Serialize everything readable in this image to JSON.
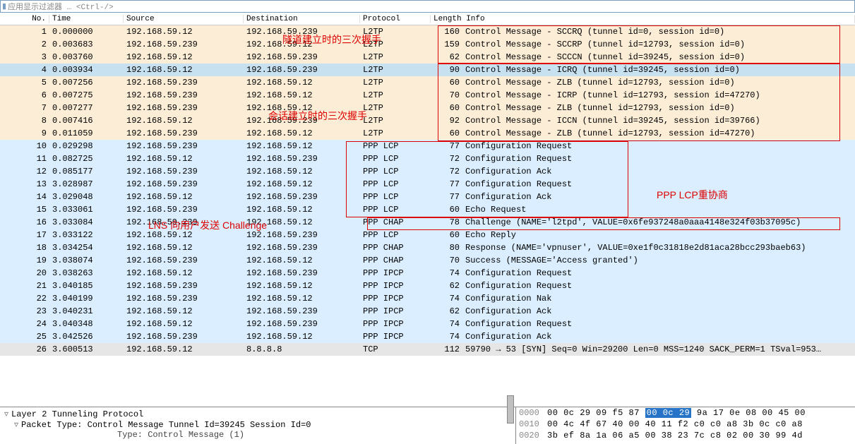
{
  "filter_bar": {
    "placeholder": "应用显示过滤器 … <Ctrl-/>"
  },
  "headers": {
    "no": "No.",
    "time": "Time",
    "source": "Source",
    "destination": "Destination",
    "protocol": "Protocol",
    "length_info": "Length  Info"
  },
  "packets": [
    {
      "no": "1",
      "time": "0.000000",
      "src": "192.168.59.12",
      "dst": "192.168.59.239",
      "proto": "L2TP",
      "len": "160",
      "info": "Control Message - SCCRQ (tunnel id=0, session id=0)",
      "cls": "l2tp"
    },
    {
      "no": "2",
      "time": "0.003683",
      "src": "192.168.59.239",
      "dst": "192.168.59.12",
      "proto": "L2TP",
      "len": "159",
      "info": "Control Message - SCCRP (tunnel id=12793, session id=0)",
      "cls": "l2tp"
    },
    {
      "no": "3",
      "time": "0.003760",
      "src": "192.168.59.12",
      "dst": "192.168.59.239",
      "proto": "L2TP",
      "len": "62",
      "info": "Control Message - SCCCN (tunnel id=39245, session id=0)",
      "cls": "l2tp"
    },
    {
      "no": "4",
      "time": "0.003934",
      "src": "192.168.59.12",
      "dst": "192.168.59.239",
      "proto": "L2TP",
      "len": "90",
      "info": "Control Message - ICRQ (tunnel id=39245, session id=0)",
      "cls": "l2tp-sel"
    },
    {
      "no": "5",
      "time": "0.007256",
      "src": "192.168.59.239",
      "dst": "192.168.59.12",
      "proto": "L2TP",
      "len": "60",
      "info": "Control Message - ZLB     (tunnel id=12793, session id=0)",
      "cls": "l2tp"
    },
    {
      "no": "6",
      "time": "0.007275",
      "src": "192.168.59.239",
      "dst": "192.168.59.12",
      "proto": "L2TP",
      "len": "70",
      "info": "Control Message - ICRP (tunnel id=12793, session id=47270)",
      "cls": "l2tp"
    },
    {
      "no": "7",
      "time": "0.007277",
      "src": "192.168.59.239",
      "dst": "192.168.59.12",
      "proto": "L2TP",
      "len": "60",
      "info": "Control Message - ZLB     (tunnel id=12793, session id=0)",
      "cls": "l2tp"
    },
    {
      "no": "8",
      "time": "0.007416",
      "src": "192.168.59.12",
      "dst": "192.168.59.239",
      "proto": "L2TP",
      "len": "92",
      "info": "Control Message - ICCN (tunnel id=39245, session id=39766)",
      "cls": "l2tp"
    },
    {
      "no": "9",
      "time": "0.011059",
      "src": "192.168.59.239",
      "dst": "192.168.59.12",
      "proto": "L2TP",
      "len": "60",
      "info": "Control Message - ZLB     (tunnel id=12793, session id=47270)",
      "cls": "l2tp"
    },
    {
      "no": "10",
      "time": "0.029298",
      "src": "192.168.59.239",
      "dst": "192.168.59.12",
      "proto": "PPP LCP",
      "len": "77",
      "info": "Configuration Request",
      "cls": "ppp"
    },
    {
      "no": "11",
      "time": "0.082725",
      "src": "192.168.59.12",
      "dst": "192.168.59.239",
      "proto": "PPP LCP",
      "len": "72",
      "info": "Configuration Request",
      "cls": "ppp"
    },
    {
      "no": "12",
      "time": "0.085177",
      "src": "192.168.59.239",
      "dst": "192.168.59.12",
      "proto": "PPP LCP",
      "len": "72",
      "info": "Configuration Ack",
      "cls": "ppp"
    },
    {
      "no": "13",
      "time": "3.028987",
      "src": "192.168.59.239",
      "dst": "192.168.59.12",
      "proto": "PPP LCP",
      "len": "77",
      "info": "Configuration Request",
      "cls": "ppp"
    },
    {
      "no": "14",
      "time": "3.029048",
      "src": "192.168.59.12",
      "dst": "192.168.59.239",
      "proto": "PPP LCP",
      "len": "77",
      "info": "Configuration Ack",
      "cls": "ppp"
    },
    {
      "no": "15",
      "time": "3.033061",
      "src": "192.168.59.239",
      "dst": "192.168.59.12",
      "proto": "PPP LCP",
      "len": "60",
      "info": "Echo Request",
      "cls": "ppp"
    },
    {
      "no": "16",
      "time": "3.033084",
      "src": "192.168.59.239",
      "dst": "192.168.59.12",
      "proto": "PPP CHAP",
      "len": "78",
      "info": "Challenge (NAME='l2tpd', VALUE=0x6fe937248a0aaa4148e324f03b37095c)",
      "cls": "ppp"
    },
    {
      "no": "17",
      "time": "3.033122",
      "src": "192.168.59.12",
      "dst": "192.168.59.239",
      "proto": "PPP LCP",
      "len": "60",
      "info": "Echo Reply",
      "cls": "ppp"
    },
    {
      "no": "18",
      "time": "3.034254",
      "src": "192.168.59.12",
      "dst": "192.168.59.239",
      "proto": "PPP CHAP",
      "len": "80",
      "info": "Response (NAME='vpnuser', VALUE=0xe1f0c31818e2d81aca28bcc293baeb63)",
      "cls": "ppp"
    },
    {
      "no": "19",
      "time": "3.038074",
      "src": "192.168.59.239",
      "dst": "192.168.59.12",
      "proto": "PPP CHAP",
      "len": "70",
      "info": "Success (MESSAGE='Access granted')",
      "cls": "ppp"
    },
    {
      "no": "20",
      "time": "3.038263",
      "src": "192.168.59.12",
      "dst": "192.168.59.239",
      "proto": "PPP IPCP",
      "len": "74",
      "info": "Configuration Request",
      "cls": "ppp"
    },
    {
      "no": "21",
      "time": "3.040185",
      "src": "192.168.59.239",
      "dst": "192.168.59.12",
      "proto": "PPP IPCP",
      "len": "62",
      "info": "Configuration Request",
      "cls": "ppp"
    },
    {
      "no": "22",
      "time": "3.040199",
      "src": "192.168.59.239",
      "dst": "192.168.59.12",
      "proto": "PPP IPCP",
      "len": "74",
      "info": "Configuration Nak",
      "cls": "ppp"
    },
    {
      "no": "23",
      "time": "3.040231",
      "src": "192.168.59.12",
      "dst": "192.168.59.239",
      "proto": "PPP IPCP",
      "len": "62",
      "info": "Configuration Ack",
      "cls": "ppp"
    },
    {
      "no": "24",
      "time": "3.040348",
      "src": "192.168.59.12",
      "dst": "192.168.59.239",
      "proto": "PPP IPCP",
      "len": "74",
      "info": "Configuration Request",
      "cls": "ppp"
    },
    {
      "no": "25",
      "time": "3.042526",
      "src": "192.168.59.239",
      "dst": "192.168.59.12",
      "proto": "PPP IPCP",
      "len": "74",
      "info": "Configuration Ack",
      "cls": "ppp"
    },
    {
      "no": "26",
      "time": "3.600513",
      "src": "192.168.59.12",
      "dst": "8.8.8.8",
      "proto": "TCP",
      "len": "112",
      "info": "59790 → 53 [SYN] Seq=0 Win=29200 Len=0 MSS=1240 SACK_PERM=1 TSval=953…",
      "cls": "tcp"
    }
  ],
  "details": {
    "line1": "Layer 2 Tunneling Protocol",
    "line2": "Packet Type: Control Message Tunnel Id=39245 Session Id=0",
    "line3": "Type: Control Message (1)"
  },
  "hex": {
    "r0_off": "0000",
    "r0_a": "00 0c 29 09 f5 87 ",
    "r0_sel": "00 0c 29",
    "r0_b": " 9a 17 0e 08 00 45 00",
    "r1_off": "0010",
    "r1": "00 4c 4f 67 40 00 40 11  f2 c0 c0 a8 3b 0c c0 a8",
    "r2_off": "0020",
    "r2": "3b ef 8a 1a 06 a5 00 38  23 7c c8 02 00 30 99 4d"
  },
  "annotations": {
    "a1": "隧道建立时的三次握手",
    "a2": "会话建立时的三次握手",
    "a3": "PPP LCP重协商",
    "a4": "LNS 向用户发送 Challenge"
  },
  "watermark": ""
}
